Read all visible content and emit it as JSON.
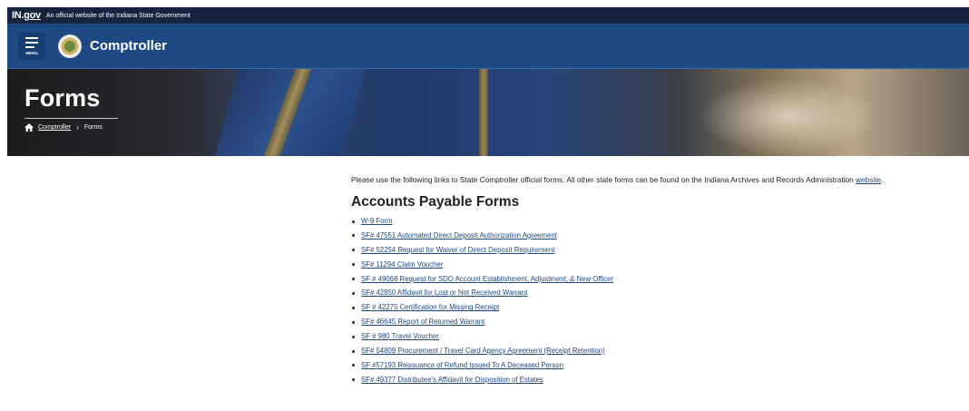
{
  "gov_bar": {
    "logo_in": "IN",
    "logo_gov": "gov",
    "text": "An official website of the Indiana State Government"
  },
  "header": {
    "menu_label": "MENU",
    "site_name": "Comptroller"
  },
  "hero": {
    "title": "Forms",
    "breadcrumb": {
      "home": "Comptroller",
      "current": "Forms"
    }
  },
  "intro": {
    "text": "Please use the following links to State Comptroller official forms.  All other state forms can be found on the Indiana Archives and Records Administration ",
    "link": "website",
    "end": "."
  },
  "section": {
    "title": "Accounts Payable Forms",
    "items": [
      "W-9 Form",
      "SF# 47551 Automated Direct Deposit Authorization Agreement",
      "SF# 52254 Request for Waiver of Direct Deposit Requirement",
      "SF# 11294 Claim Voucher",
      "SF # 49068 Request for SDO Account Establishment, Adjustment, & New Officer",
      "SF# 42850 Affidavit for Lost or Not Received Warrant",
      "SF # 42275 Certification for Missing Receipt",
      "SF# 46645 Report of Returned Warrant",
      "SF # 980 Travel Voucher",
      "SF# 54809 Procurement / Travel Card Agency Agreement (Receipt Retention)",
      "SF #57193 Reissuance of Refund Issued To A Deceased Person",
      "SF# 49377 Distributee's Affidavit for Disposition of Estates"
    ]
  },
  "colors": {
    "gov_bar": "#16243f",
    "header": "#1d4a84",
    "link": "#1d4a84"
  },
  "icons": {
    "menu": "hamburger-icon",
    "seal": "state-seal-icon",
    "home": "home-icon"
  }
}
